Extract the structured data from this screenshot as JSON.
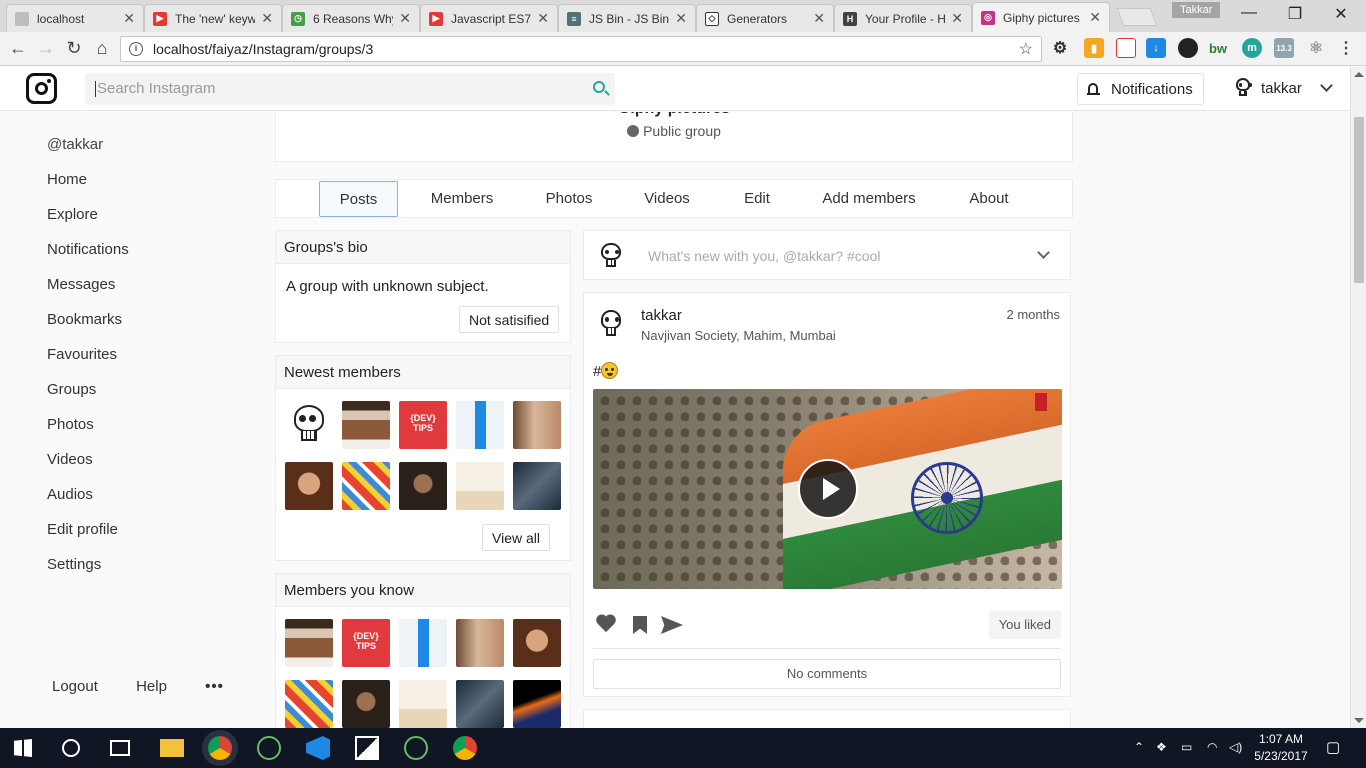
{
  "browser": {
    "tabs": [
      {
        "title": "localhost",
        "icon": "page-icon",
        "color": "#9e9e9e"
      },
      {
        "title": "The 'new' keyw",
        "icon": "youtube-icon",
        "color": "#e53935"
      },
      {
        "title": "6 Reasons Why",
        "icon": "clock-icon",
        "color": "#43a047"
      },
      {
        "title": "Javascript ES7",
        "icon": "youtube-icon",
        "color": "#e53935"
      },
      {
        "title": "JS Bin - JS Bin",
        "icon": "jsbin-icon",
        "color": "#546e7a"
      },
      {
        "title": "Generators",
        "icon": "codepen-icon",
        "color": "#424242"
      },
      {
        "title": "Your Profile - H",
        "icon": "h-icon",
        "color": "#424242"
      },
      {
        "title": "Giphy pictures",
        "icon": "instagram-icon",
        "color": "#c13584"
      }
    ],
    "profile_name": "Takkar",
    "url": "localhost/faiyaz/Instagram/groups/3"
  },
  "header": {
    "search_placeholder": "Search Instagram",
    "notifications_label": "Notifications",
    "username": "takkar"
  },
  "sidebar": {
    "handle": "@takkar",
    "items": [
      "Home",
      "Explore",
      "Notifications",
      "Messages",
      "Bookmarks",
      "Favourites",
      "Groups",
      "Photos",
      "Videos",
      "Audios",
      "Edit profile",
      "Settings"
    ],
    "footer": {
      "logout": "Logout",
      "help": "Help",
      "more": "•••"
    }
  },
  "group": {
    "title": "Giphy pictures",
    "privacy": "Public group",
    "tabs": [
      "Posts",
      "Members",
      "Photos",
      "Videos",
      "Edit",
      "Add members",
      "About"
    ],
    "active_tab": "Posts"
  },
  "bio": {
    "title": "Groups's bio",
    "text": "A group with unknown subject.",
    "button": "Not satisified"
  },
  "newest_members": {
    "title": "Newest members",
    "view_all": "View all"
  },
  "members_you_know": {
    "title": "Members you know"
  },
  "composer": {
    "placeholder": "What's new with you, @takkar? #cool"
  },
  "post": {
    "username": "takkar",
    "location": "Navjivan Society, Mahim, Mumbai",
    "time": "2 months",
    "caption": "#",
    "liked_label": "You liked",
    "comments_label": "No comments"
  },
  "taskbar": {
    "time": "1:07 AM",
    "date": "5/23/2017"
  }
}
